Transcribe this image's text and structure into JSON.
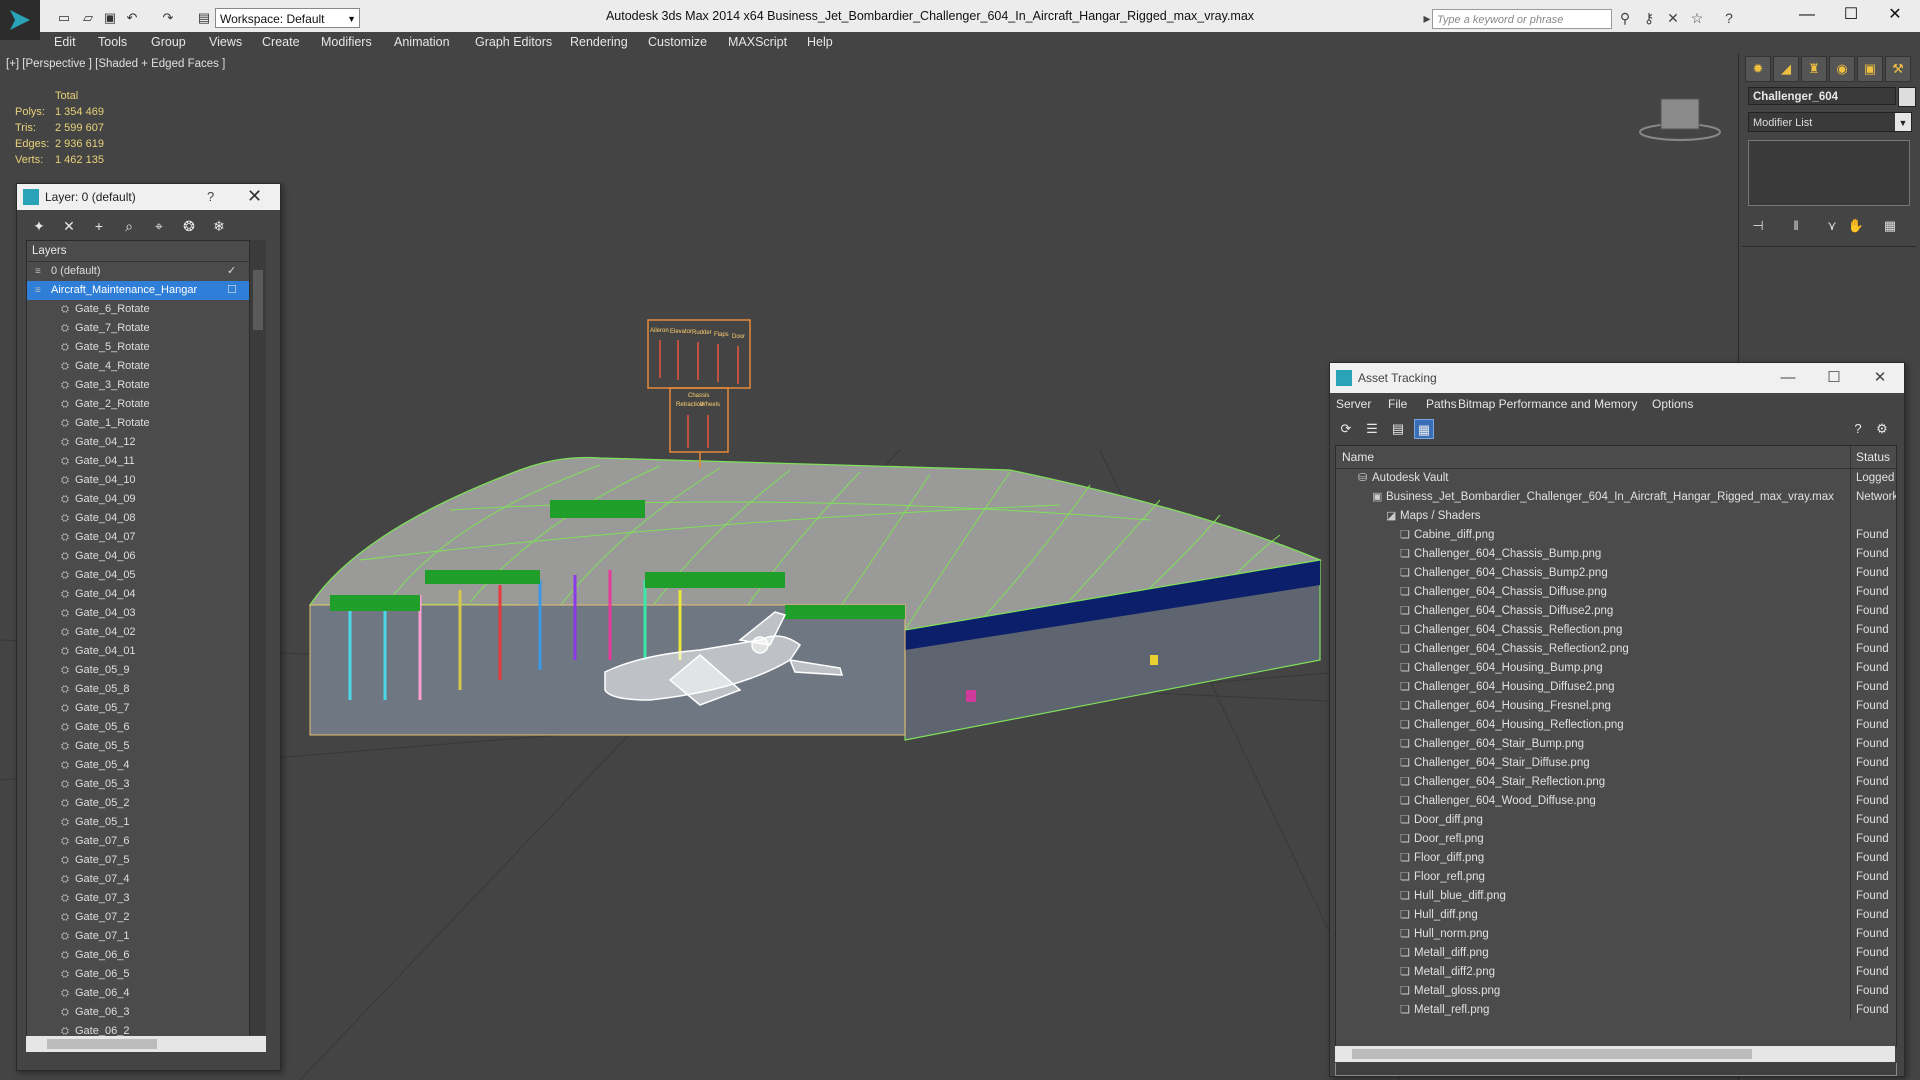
{
  "app": {
    "window_title": "Autodesk 3ds Max  2014 x64       Business_Jet_Bombardier_Challenger_604_In_Aircraft_Hangar_Rigged_max_vray.max",
    "workspace": "Workspace: Default",
    "search_placeholder": "Type a keyword or phrase"
  },
  "menu": [
    "Edit",
    "Tools",
    "Group",
    "Views",
    "Create",
    "Modifiers",
    "Animation",
    "Graph Editors",
    "Rendering",
    "Customize",
    "MAXScript",
    "Help"
  ],
  "viewport": {
    "label": "[+] [Perspective ] [Shaded + Edged Faces ]",
    "stats": {
      "header": "Total",
      "rows": [
        {
          "label": "Polys:",
          "value": "1 354 469"
        },
        {
          "label": "Tris:",
          "value": "2 599 607"
        },
        {
          "label": "Edges:",
          "value": "2 936 619"
        },
        {
          "label": "Verts:",
          "value": "1 462 135"
        }
      ]
    }
  },
  "command_panel": {
    "object_name": "Challenger_604",
    "modifier_list": "Modifier List"
  },
  "layer_dialog": {
    "title": "Layer: 0 (default)",
    "help": "?",
    "header": "Layers",
    "layers": [
      {
        "name": "0 (default)",
        "level": 0
      },
      {
        "name": "Aircraft_Maintenance_Hangar",
        "level": 0,
        "selected": true
      },
      {
        "name": "Gate_6_Rotate",
        "level": 1
      },
      {
        "name": "Gate_7_Rotate",
        "level": 1
      },
      {
        "name": "Gate_5_Rotate",
        "level": 1
      },
      {
        "name": "Gate_4_Rotate",
        "level": 1
      },
      {
        "name": "Gate_3_Rotate",
        "level": 1
      },
      {
        "name": "Gate_2_Rotate",
        "level": 1
      },
      {
        "name": "Gate_1_Rotate",
        "level": 1
      },
      {
        "name": "Gate_04_12",
        "level": 1
      },
      {
        "name": "Gate_04_11",
        "level": 1
      },
      {
        "name": "Gate_04_10",
        "level": 1
      },
      {
        "name": "Gate_04_09",
        "level": 1
      },
      {
        "name": "Gate_04_08",
        "level": 1
      },
      {
        "name": "Gate_04_07",
        "level": 1
      },
      {
        "name": "Gate_04_06",
        "level": 1
      },
      {
        "name": "Gate_04_05",
        "level": 1
      },
      {
        "name": "Gate_04_04",
        "level": 1
      },
      {
        "name": "Gate_04_03",
        "level": 1
      },
      {
        "name": "Gate_04_02",
        "level": 1
      },
      {
        "name": "Gate_04_01",
        "level": 1
      },
      {
        "name": "Gate_05_9",
        "level": 1
      },
      {
        "name": "Gate_05_8",
        "level": 1
      },
      {
        "name": "Gate_05_7",
        "level": 1
      },
      {
        "name": "Gate_05_6",
        "level": 1
      },
      {
        "name": "Gate_05_5",
        "level": 1
      },
      {
        "name": "Gate_05_4",
        "level": 1
      },
      {
        "name": "Gate_05_3",
        "level": 1
      },
      {
        "name": "Gate_05_2",
        "level": 1
      },
      {
        "name": "Gate_05_1",
        "level": 1
      },
      {
        "name": "Gate_07_6",
        "level": 1
      },
      {
        "name": "Gate_07_5",
        "level": 1
      },
      {
        "name": "Gate_07_4",
        "level": 1
      },
      {
        "name": "Gate_07_3",
        "level": 1
      },
      {
        "name": "Gate_07_2",
        "level": 1
      },
      {
        "name": "Gate_07_1",
        "level": 1
      },
      {
        "name": "Gate_06_6",
        "level": 1
      },
      {
        "name": "Gate_06_5",
        "level": 1
      },
      {
        "name": "Gate_06_4",
        "level": 1
      },
      {
        "name": "Gate_06_3",
        "level": 1
      },
      {
        "name": "Gate_06_2",
        "level": 1
      }
    ]
  },
  "asset_dialog": {
    "title": "Asset Tracking",
    "menu": [
      "Server",
      "File",
      "Paths",
      "Bitmap Performance and Memory",
      "Options"
    ],
    "columns": {
      "name": "Name",
      "status": "Status"
    },
    "rows": [
      {
        "name": "Autodesk Vault",
        "status": "Logged O",
        "indent": 0,
        "icon": "vault"
      },
      {
        "name": "Business_Jet_Bombardier_Challenger_604_In_Aircraft_Hangar_Rigged_max_vray.max",
        "status": "Network F",
        "indent": 1,
        "icon": "max"
      },
      {
        "name": "Maps / Shaders",
        "status": "",
        "indent": 2,
        "icon": "maps"
      },
      {
        "name": "Cabine_diff.png",
        "status": "Found",
        "indent": 3,
        "icon": "file"
      },
      {
        "name": "Challenger_604_Chassis_Bump.png",
        "status": "Found",
        "indent": 3,
        "icon": "file"
      },
      {
        "name": "Challenger_604_Chassis_Bump2.png",
        "status": "Found",
        "indent": 3,
        "icon": "file"
      },
      {
        "name": "Challenger_604_Chassis_Diffuse.png",
        "status": "Found",
        "indent": 3,
        "icon": "file"
      },
      {
        "name": "Challenger_604_Chassis_Diffuse2.png",
        "status": "Found",
        "indent": 3,
        "icon": "file"
      },
      {
        "name": "Challenger_604_Chassis_Reflection.png",
        "status": "Found",
        "indent": 3,
        "icon": "file"
      },
      {
        "name": "Challenger_604_Chassis_Reflection2.png",
        "status": "Found",
        "indent": 3,
        "icon": "file"
      },
      {
        "name": "Challenger_604_Housing_Bump.png",
        "status": "Found",
        "indent": 3,
        "icon": "file"
      },
      {
        "name": "Challenger_604_Housing_Diffuse2.png",
        "status": "Found",
        "indent": 3,
        "icon": "file"
      },
      {
        "name": "Challenger_604_Housing_Fresnel.png",
        "status": "Found",
        "indent": 3,
        "icon": "file"
      },
      {
        "name": "Challenger_604_Housing_Reflection.png",
        "status": "Found",
        "indent": 3,
        "icon": "file"
      },
      {
        "name": "Challenger_604_Stair_Bump.png",
        "status": "Found",
        "indent": 3,
        "icon": "file"
      },
      {
        "name": "Challenger_604_Stair_Diffuse.png",
        "status": "Found",
        "indent": 3,
        "icon": "file"
      },
      {
        "name": "Challenger_604_Stair_Reflection.png",
        "status": "Found",
        "indent": 3,
        "icon": "file"
      },
      {
        "name": "Challenger_604_Wood_Diffuse.png",
        "status": "Found",
        "indent": 3,
        "icon": "file"
      },
      {
        "name": "Door_diff.png",
        "status": "Found",
        "indent": 3,
        "icon": "file"
      },
      {
        "name": "Door_refl.png",
        "status": "Found",
        "indent": 3,
        "icon": "file"
      },
      {
        "name": "Floor_diff.png",
        "status": "Found",
        "indent": 3,
        "icon": "file"
      },
      {
        "name": "Floor_refl.png",
        "status": "Found",
        "indent": 3,
        "icon": "file"
      },
      {
        "name": "Hull_blue_diff.png",
        "status": "Found",
        "indent": 3,
        "icon": "file"
      },
      {
        "name": "Hull_diff.png",
        "status": "Found",
        "indent": 3,
        "icon": "file"
      },
      {
        "name": "Hull_norm.png",
        "status": "Found",
        "indent": 3,
        "icon": "file"
      },
      {
        "name": "Metall_diff.png",
        "status": "Found",
        "indent": 3,
        "icon": "file"
      },
      {
        "name": "Metall_diff2.png",
        "status": "Found",
        "indent": 3,
        "icon": "file"
      },
      {
        "name": "Metall_gloss.png",
        "status": "Found",
        "indent": 3,
        "icon": "file"
      },
      {
        "name": "Metall_refl.png",
        "status": "Found",
        "indent": 3,
        "icon": "file"
      }
    ]
  },
  "billboard": {
    "top_labels": [
      "Aileron",
      "Elevator",
      "Rudder",
      "Flaps",
      "Door"
    ],
    "bottom_labels": [
      "Chassis",
      "Retraction",
      "Wheels"
    ]
  },
  "colors": {
    "accent": "#2f7fd8",
    "stats": "#e8d27a",
    "wireframe": "#7fe05a"
  }
}
